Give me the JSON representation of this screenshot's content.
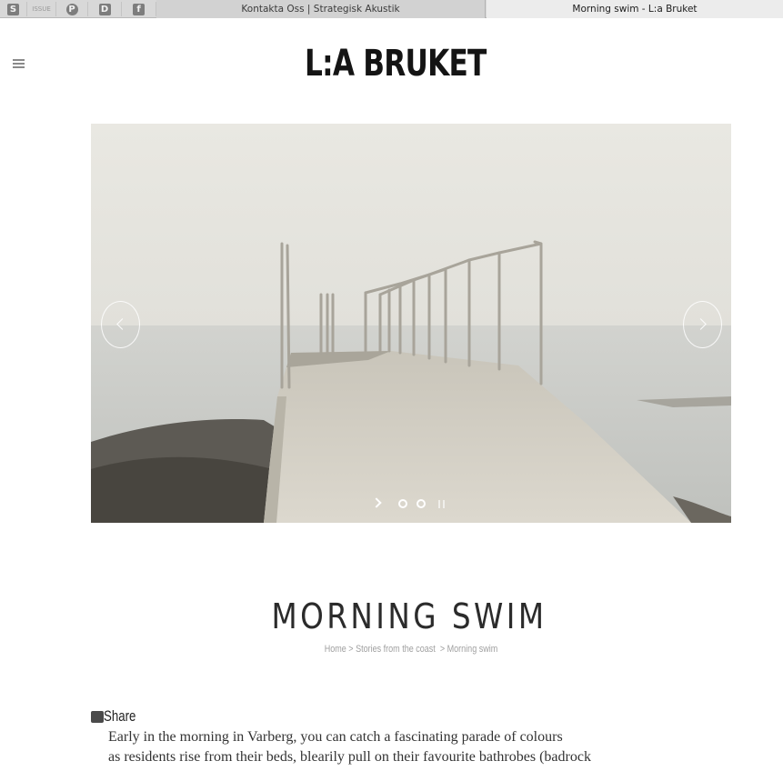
{
  "browser": {
    "bookmarks": [
      {
        "icon": "s-square-icon",
        "glyph": "S"
      },
      {
        "icon": "thin-text-icon",
        "glyph": "ISSUE"
      },
      {
        "icon": "pinterest-icon",
        "glyph": "P"
      },
      {
        "icon": "d-square-icon",
        "glyph": "D"
      },
      {
        "icon": "facebook-icon",
        "glyph": "f"
      }
    ],
    "tabs": [
      {
        "title": "Kontakta Oss | Strategisk Akustik",
        "active": false
      },
      {
        "title": "Morning swim - L:a Bruket",
        "active": true
      }
    ]
  },
  "header": {
    "logo": "L:A BRUKET",
    "menu_icon": "hamburger-menu-icon"
  },
  "slider": {
    "image_alt": "Concrete pier with metal railings extending into a calm grey sea",
    "prev_icon": "chevron-left-icon",
    "next_icon": "chevron-right-icon",
    "play_icon": "play-icon",
    "pause_icon": "pause-icon",
    "slide_count": 2,
    "colors": {
      "sky": "#e5e3dc",
      "sea": "#c9cac6",
      "rock": "#5e5b55",
      "pier": "#d3cfc4"
    }
  },
  "article": {
    "title": "MORNING SWIM",
    "breadcrumb": {
      "home": "Home",
      "separator": ">",
      "section": "Stories from the coast",
      "current": "Morning swim"
    },
    "share_label": "Share",
    "paragraph_lines": [
      "Early in the morning in Varberg, you can catch a fascinating parade of colours",
      "as residents rise from their beds, blearily pull on their favourite bathrobes (badrock"
    ]
  }
}
